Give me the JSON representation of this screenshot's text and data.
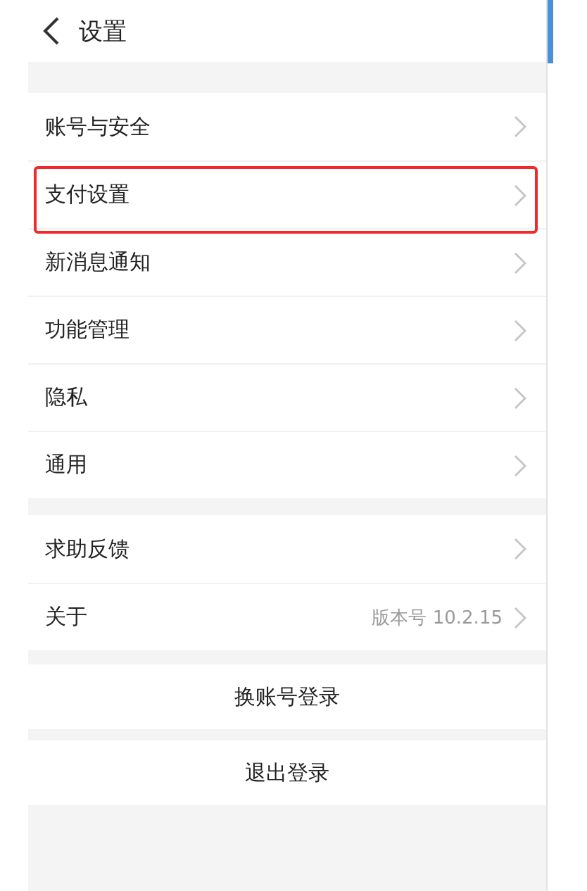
{
  "header": {
    "title": "设置"
  },
  "sections": [
    {
      "items": [
        {
          "kind": "nav",
          "label": "账号与安全",
          "highlighted": false
        },
        {
          "kind": "nav",
          "label": "支付设置",
          "highlighted": true
        },
        {
          "kind": "nav",
          "label": "新消息通知",
          "highlighted": false
        },
        {
          "kind": "nav",
          "label": "功能管理",
          "highlighted": false
        },
        {
          "kind": "nav",
          "label": "隐私",
          "highlighted": false
        },
        {
          "kind": "nav",
          "label": "通用",
          "highlighted": false
        }
      ]
    },
    {
      "items": [
        {
          "kind": "nav",
          "label": "求助反馈",
          "highlighted": false
        },
        {
          "kind": "nav",
          "label": "关于",
          "value": "版本号 10.2.15",
          "highlighted": false
        }
      ]
    },
    {
      "items": [
        {
          "kind": "action",
          "label": "换账号登录",
          "highlighted": false
        }
      ]
    },
    {
      "items": [
        {
          "kind": "action",
          "label": "退出登录",
          "highlighted": false
        }
      ]
    }
  ]
}
